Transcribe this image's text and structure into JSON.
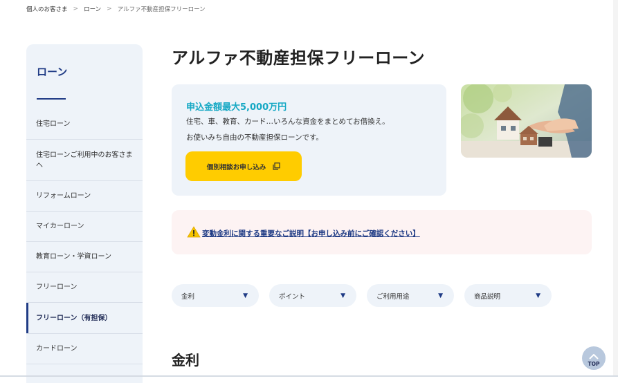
{
  "breadcrumb": {
    "items": [
      "個人のお客さま",
      "ローン",
      "アルファ不動産担保フリーローン"
    ],
    "separator": ">"
  },
  "sidebar": {
    "title": "ローン",
    "items": [
      {
        "label": "住宅ローン"
      },
      {
        "label": "住宅ローンご利用中のお客さまへ"
      },
      {
        "label": "リフォームローン"
      },
      {
        "label": "マイカーローン"
      },
      {
        "label": "教育ローン・学資ローン"
      },
      {
        "label": "フリーローン"
      },
      {
        "label": "フリーローン（有担保）",
        "active": true
      },
      {
        "label": "カードローン"
      }
    ]
  },
  "page": {
    "title": "アルファ不動産担保フリーローン"
  },
  "promo": {
    "headline": "申込金額最大5,000万円",
    "line1": "住宅、車、教育、カード…いろんな資金をまとめてお借換え。",
    "line2": "お使いみち自由の不動産担保ローンです。",
    "cta_label": "個別相談お申し込み",
    "cta_icon": "external-link-icon"
  },
  "notice": {
    "icon": "warning-icon",
    "link_text": "変動金利に関する重要なご説明【お申し込み前にご確認ください】"
  },
  "filters": [
    {
      "label": "金利"
    },
    {
      "label": "ポイント"
    },
    {
      "label": "ご利用用途"
    },
    {
      "label": "商品説明"
    }
  ],
  "section": {
    "title": "金利"
  },
  "top_button": {
    "label": "TOP"
  },
  "colors": {
    "accent_navy": "#1f3b85",
    "accent_teal": "#15a8c4",
    "cta_yellow": "#ffcc00",
    "panel_bg": "#eef3f9",
    "notice_bg": "#fdf3f3"
  }
}
